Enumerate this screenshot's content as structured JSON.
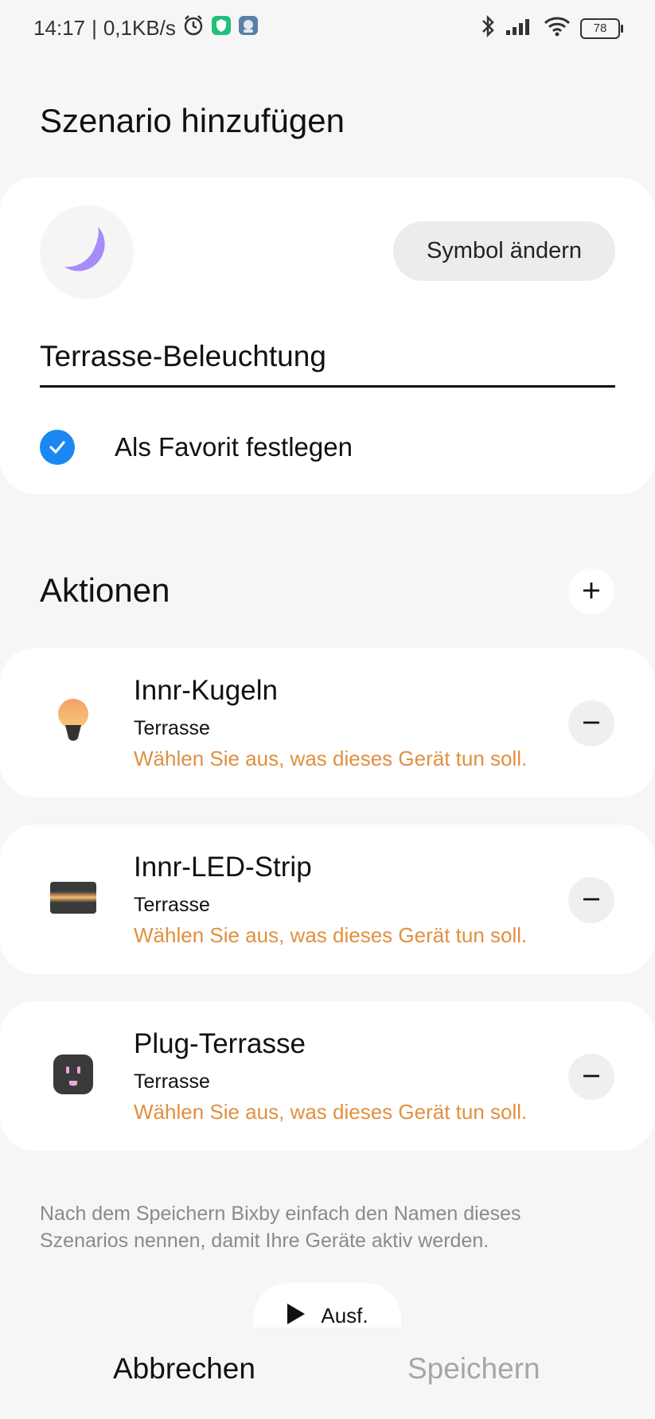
{
  "status_bar": {
    "time": "14:17",
    "net_speed": "0,1KB/s",
    "battery": "78"
  },
  "title": "Szenario hinzufügen",
  "scenario": {
    "change_symbol_label": "Symbol ändern",
    "name_value": "Terrasse-Beleuchtung",
    "favorite_label": "Als Favorit festlegen",
    "favorite_checked": true
  },
  "actions": {
    "title": "Aktionen",
    "items": [
      {
        "name": "Innr-Kugeln",
        "room": "Terrasse",
        "hint": "Wählen Sie aus, was dieses Gerät tun soll.",
        "icon": "light-bulb-icon"
      },
      {
        "name": "Innr-LED-Strip",
        "room": "Terrasse",
        "hint": "Wählen Sie aus, was dieses Gerät tun soll.",
        "icon": "led-strip-icon"
      },
      {
        "name": "Plug-Terrasse",
        "room": "Terrasse",
        "hint": "Wählen Sie aus, was dieses Gerät tun soll.",
        "icon": "smart-plug-icon"
      }
    ]
  },
  "info_text": "Nach dem Speichern Bixby einfach den Namen dieses Szenarios nennen, damit Ihre Geräte aktiv werden.",
  "run_label": "Ausf.",
  "bottom": {
    "cancel_label": "Abbrechen",
    "save_label": "Speichern"
  },
  "colors": {
    "accent": "#1a88f0",
    "hint": "#e09040",
    "moon": "#a78bfa",
    "background": "#f6f6f6"
  }
}
